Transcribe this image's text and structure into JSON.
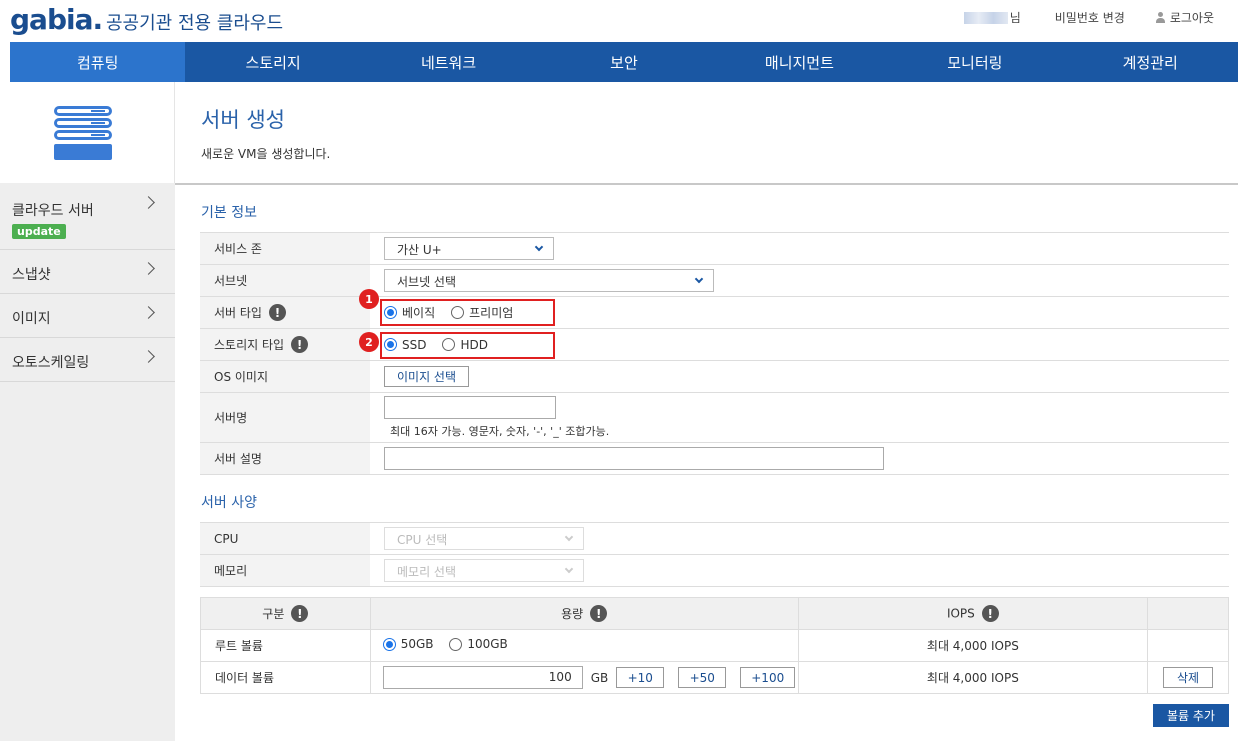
{
  "header": {
    "logo": "gabia.",
    "subtitle": "공공기관 전용 클라우드",
    "user_suffix": "님",
    "change_password": "비밀번호 변경",
    "logout": "로그아웃"
  },
  "nav": [
    "컴퓨팅",
    "스토리지",
    "네트워크",
    "보안",
    "매니지먼트",
    "모니터링",
    "계정관리"
  ],
  "sidebar": {
    "items": [
      {
        "label": "클라우드 서버",
        "badge": "update"
      },
      {
        "label": "스냅샷"
      },
      {
        "label": "이미지"
      },
      {
        "label": "오토스케일링"
      }
    ]
  },
  "page": {
    "title": "서버 생성",
    "desc": "새로운 VM을 생성합니다."
  },
  "basic": {
    "section": "기본 정보",
    "zone_label": "서비스 존",
    "zone_value": "가산 U+",
    "subnet_label": "서브넷",
    "subnet_value": "서브넷 선택",
    "type_label": "서버 타입",
    "type_basic": "베이직",
    "type_premium": "프리미엄",
    "storage_label": "스토리지 타입",
    "storage_ssd": "SSD",
    "storage_hdd": "HDD",
    "os_label": "OS 이미지",
    "os_button": "이미지 선택",
    "name_label": "서버명",
    "name_hint": "최대 16자 가능. 영문자, 숫자, '-', '_' 조합가능.",
    "desc_label": "서버 설명"
  },
  "markers": {
    "one": "1",
    "two": "2"
  },
  "spec": {
    "section": "서버 사양",
    "cpu_label": "CPU",
    "cpu_placeholder": "CPU 선택",
    "mem_label": "메모리",
    "mem_placeholder": "메모리 선택"
  },
  "volume": {
    "head_type": "구분",
    "head_size": "용량",
    "head_iops": "IOPS",
    "root_label": "루트 볼륨",
    "root_50": "50GB",
    "root_100": "100GB",
    "root_iops": "최대 4,000 IOPS",
    "data_label": "데이터 볼륨",
    "data_value": "100",
    "data_unit": "GB",
    "plus10": "+10",
    "plus50": "+50",
    "plus100": "+100",
    "data_iops": "최대 4,000 IOPS",
    "delete": "삭제",
    "add": "볼륨 추가"
  },
  "icons": {
    "warn": "!",
    "server": "server-stack-icon"
  },
  "colors": {
    "nav": "#1a57a3",
    "nav_active": "#2c74cc",
    "accent": "#2a62aa",
    "highlight": "#e02020",
    "badge": "#4caf50"
  }
}
